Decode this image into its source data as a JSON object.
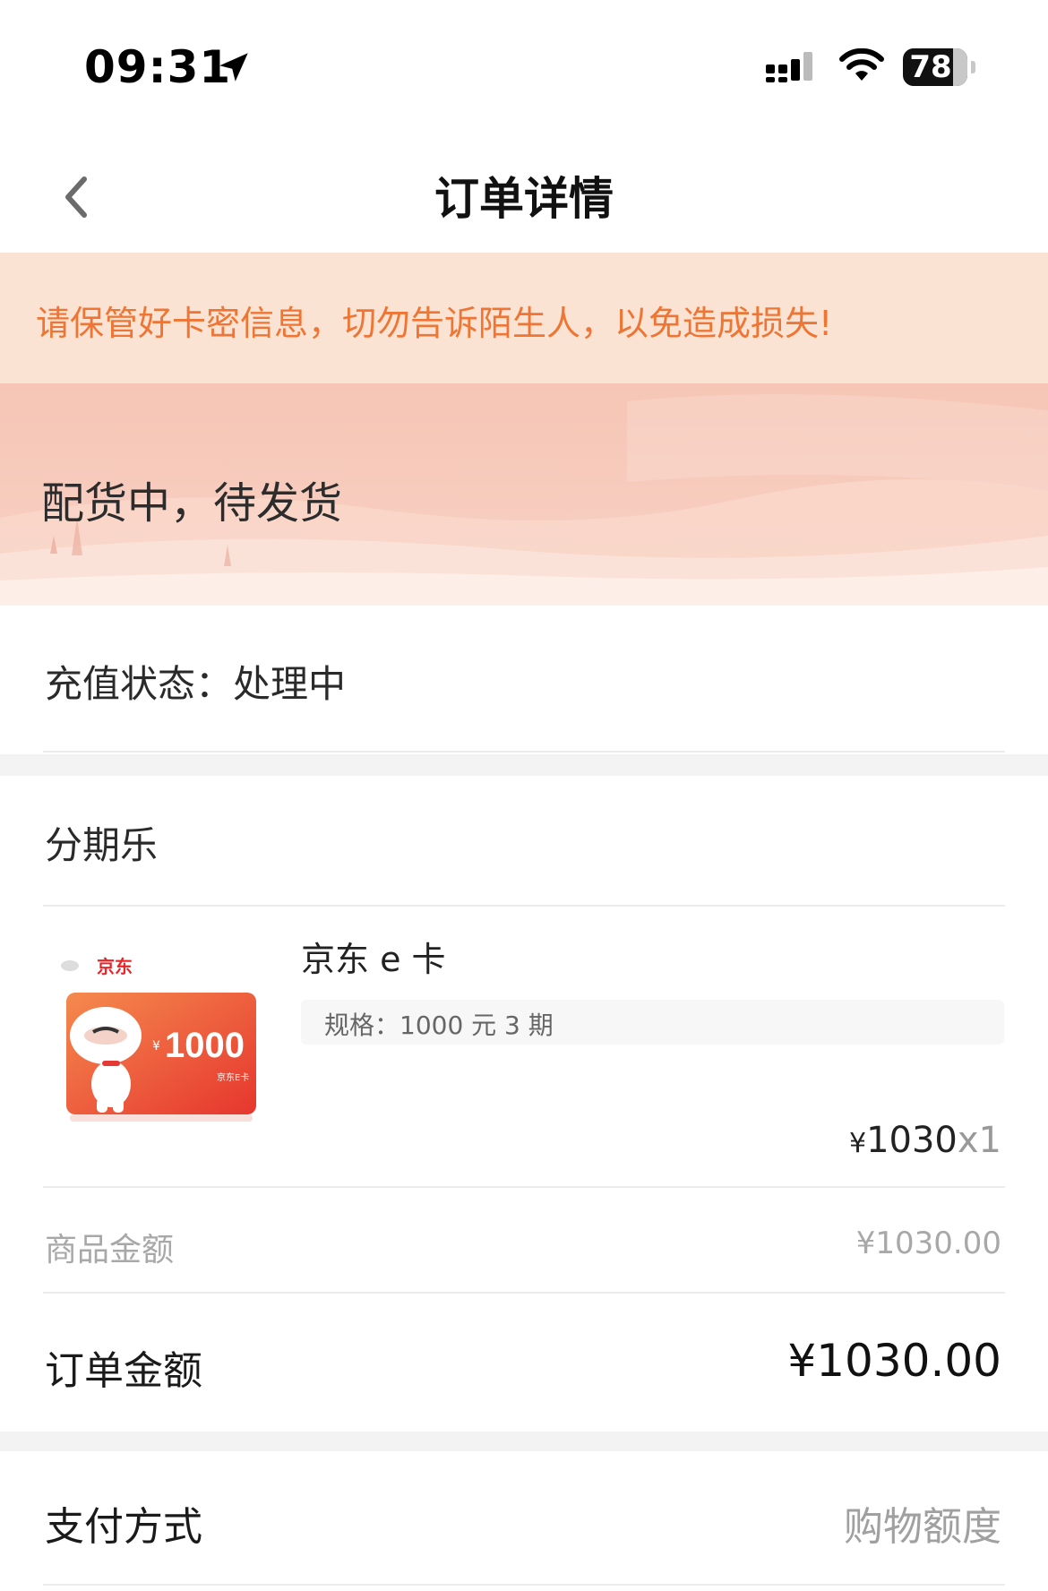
{
  "status_bar": {
    "time": "09:31",
    "battery": "78"
  },
  "nav": {
    "title": "订单详情"
  },
  "warning": {
    "text": "请保管好卡密信息，切勿告诉陌生人，以免造成损失!"
  },
  "order_status": {
    "title": "配货中，待发货"
  },
  "recharge": {
    "text": "充值状态：处理中"
  },
  "merchant": {
    "name": "分期乐"
  },
  "product": {
    "name": "京东 e 卡",
    "spec": "规格：1000 元 3 期",
    "currency": "¥",
    "price": "1030",
    "quantity": "x1",
    "thumb_brand": "京东",
    "thumb_amount": "1000",
    "thumb_currency": "¥",
    "thumb_caption": "京东E卡"
  },
  "subtotal": {
    "label": "商品金额",
    "value": "¥1030.00"
  },
  "order_total": {
    "label": "订单金额",
    "value": "¥1030.00"
  },
  "payment": {
    "label": "支付方式",
    "value": "购物额度"
  },
  "colors": {
    "accent": "#ee7533",
    "jd_red": "#e8262a"
  }
}
